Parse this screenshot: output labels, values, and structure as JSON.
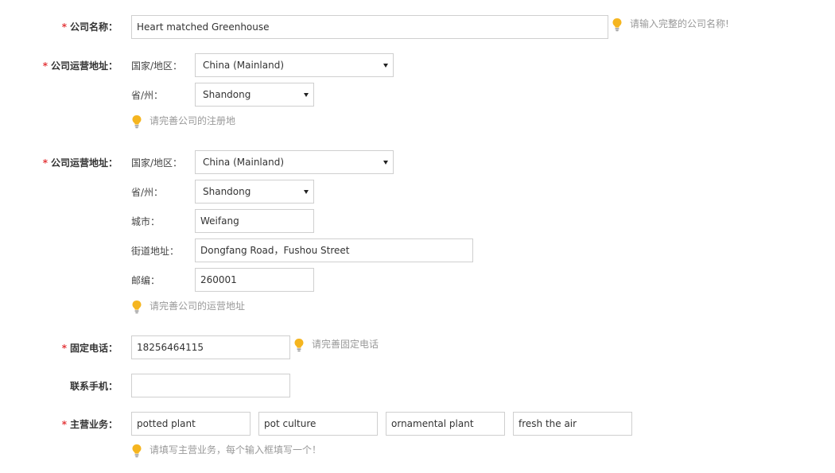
{
  "company_name": {
    "label": "公司名称：",
    "value": "Heart matched  Greenhouse",
    "hint": "请输入完整的公司名称!"
  },
  "registered_address": {
    "label": "公司运营地址：",
    "country_label": "国家/地区：",
    "country_value": "China (Mainland)",
    "province_label": "省/州：",
    "province_value": "Shandong",
    "hint": "请完善公司的注册地"
  },
  "operating_address": {
    "label": "公司运营地址：",
    "country_label": "国家/地区：",
    "country_value": "China (Mainland)",
    "province_label": "省/州：",
    "province_value": "Shandong",
    "city_label": "城市：",
    "city_value": "Weifang",
    "street_label": "街道地址：",
    "street_value": "Dongfang Road，Fushou Street",
    "zip_label": "邮编：",
    "zip_value": "260001",
    "hint": "请完善公司的运营地址"
  },
  "landline": {
    "label": "固定电话：",
    "value": "18256464115",
    "hint": "请完善固定电话"
  },
  "mobile": {
    "label": "联系手机：",
    "value": ""
  },
  "main_business": {
    "label": "主营业务：",
    "items": [
      "potted plant",
      "pot culture",
      "ornamental plant",
      "fresh the air"
    ],
    "hint": "请填写主营业务，每个输入框填写一个！"
  },
  "required_mark": "*",
  "colors": {
    "required": "#e4393c",
    "hint_text": "#999999",
    "bulb": "#f5b51f",
    "border": "#cfcfcf"
  }
}
